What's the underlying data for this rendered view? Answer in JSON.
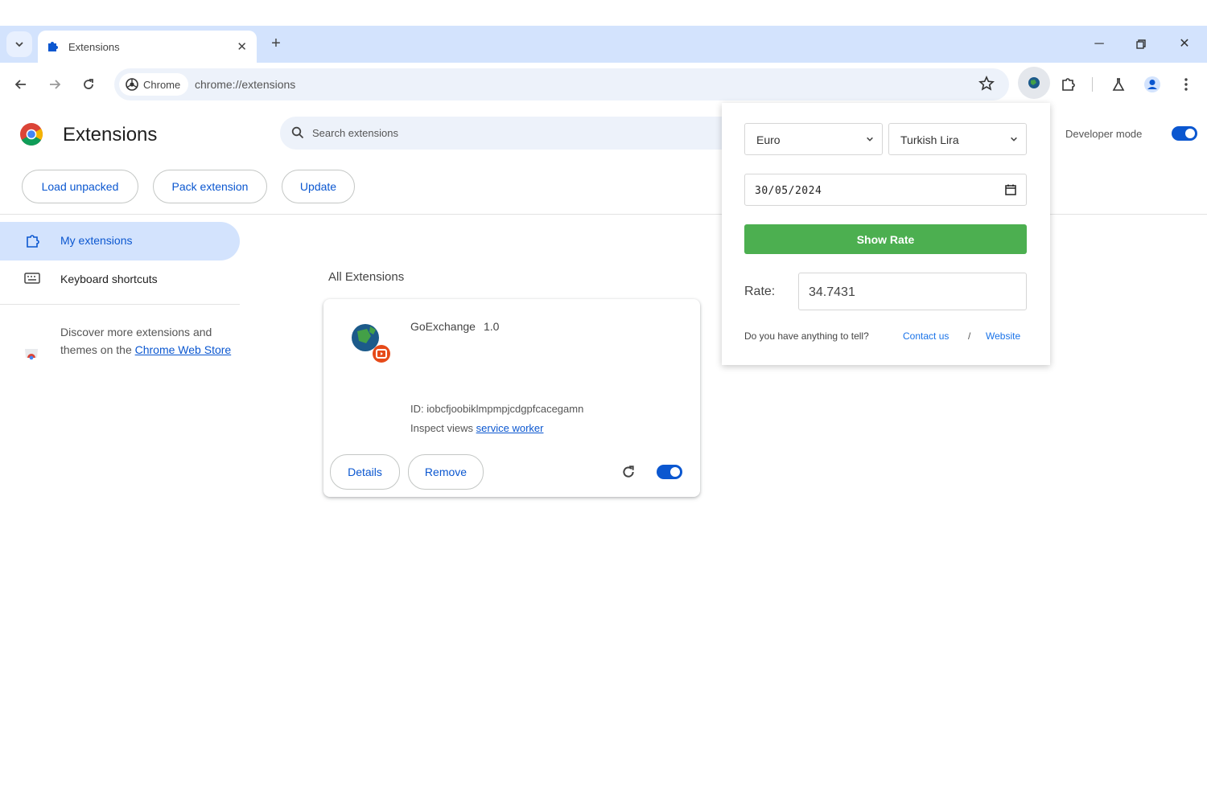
{
  "colors": {
    "accent": "#0b57d0",
    "tabstrip": "#d3e3fd",
    "show_rate_button": "#4caf50",
    "link": "#1a73e8"
  },
  "tab": {
    "title": "Extensions",
    "icon": "puzzle-icon"
  },
  "toolbar": {
    "chip_label": "Chrome",
    "url": "chrome://extensions"
  },
  "page": {
    "title": "Extensions",
    "search_placeholder": "Search extensions",
    "developer_mode_label": "Developer mode",
    "developer_mode_on": true,
    "buttons": {
      "load_unpacked": "Load unpacked",
      "pack_extension": "Pack extension",
      "update": "Update"
    }
  },
  "sidebar": {
    "items": [
      {
        "label": "My extensions",
        "icon": "puzzle-outline-icon",
        "active": true
      },
      {
        "label": "Keyboard shortcuts",
        "icon": "keyboard-icon",
        "active": false
      }
    ],
    "discover_text": "Discover more extensions and themes on the ",
    "store_link": "Chrome Web Store"
  },
  "main": {
    "section_title": "All Extensions",
    "extension": {
      "name": "GoExchange",
      "version": "1.0",
      "id_text": "ID: iobcfjoobiklmpmpjcdgpfcacegamn",
      "inspect_label": "Inspect views ",
      "inspect_link": "service worker",
      "details_label": "Details",
      "remove_label": "Remove",
      "enabled": true
    }
  },
  "popup": {
    "from_currency": "Euro",
    "to_currency": "Turkish Lira",
    "date": "30/05/2024",
    "show_rate_label": "Show Rate",
    "rate_label": "Rate:",
    "rate_value": "34.7431",
    "question": "Do you have anything to tell?",
    "contact_link": "Contact us",
    "separator": "/",
    "website_link": "Website"
  }
}
